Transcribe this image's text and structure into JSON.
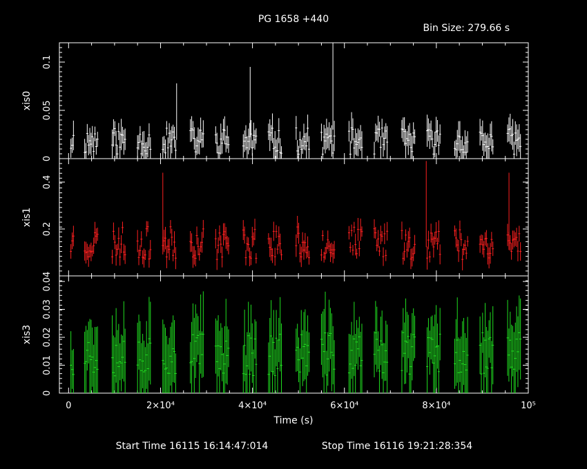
{
  "header": {
    "title": "PG 1658 +440",
    "bin_size": "Bin Size: 279.66 s"
  },
  "footer": {
    "start_time": "Start Time 16115 16:14:47:014",
    "stop_time": "Stop Time 16116 19:21:28:354"
  },
  "chart_data": [
    {
      "type": "scatter",
      "title": "PG 1658 +440",
      "ylabel": "xis0",
      "xlabel": "",
      "xlim": [
        -2000,
        100000
      ],
      "ylim": [
        0,
        0.12
      ],
      "yticks": [
        "0",
        "0.05",
        "0.1"
      ],
      "ytick_values": [
        0,
        0.05,
        0.1
      ],
      "color": "#ffffff",
      "seed": 11,
      "segments": [
        [
          500,
          1300
        ],
        [
          3500,
          6500
        ],
        [
          9500,
          12500
        ],
        [
          15000,
          18000
        ],
        [
          20500,
          23500
        ],
        [
          26500,
          29500
        ],
        [
          32000,
          35000
        ],
        [
          38000,
          41000
        ],
        [
          43500,
          46500
        ],
        [
          49500,
          52500
        ],
        [
          55000,
          58000
        ],
        [
          61000,
          64000
        ],
        [
          66500,
          69500
        ],
        [
          72500,
          75500
        ],
        [
          78000,
          81000
        ],
        [
          84000,
          87000
        ],
        [
          89500,
          92500
        ],
        [
          95500,
          98500
        ]
      ],
      "level": 0.018,
      "spread": 0.014,
      "err": 0.012,
      "spikes": [
        [
          39500,
          0.095
        ],
        [
          57500,
          0.12
        ],
        [
          23500,
          0.078
        ]
      ]
    },
    {
      "type": "scatter",
      "ylabel": "xis1",
      "xlabel": "",
      "xlim": [
        -2000,
        100000
      ],
      "ylim": [
        0,
        0.5
      ],
      "yticks": [
        "0.2",
        "0.4"
      ],
      "ytick_values": [
        0.2,
        0.4
      ],
      "color": "#ff2020",
      "seed": 23,
      "segments": [
        [
          500,
          1300
        ],
        [
          3500,
          6500
        ],
        [
          9500,
          12500
        ],
        [
          15000,
          18000
        ],
        [
          20500,
          23500
        ],
        [
          26500,
          29500
        ],
        [
          32000,
          35000
        ],
        [
          38000,
          41000
        ],
        [
          43500,
          46500
        ],
        [
          49500,
          52500
        ],
        [
          55000,
          58000
        ],
        [
          61000,
          64000
        ],
        [
          66500,
          69500
        ],
        [
          72500,
          75500
        ],
        [
          78000,
          81000
        ],
        [
          84000,
          87000
        ],
        [
          89500,
          92500
        ],
        [
          95500,
          98500
        ]
      ],
      "level": 0.14,
      "spread": 0.07,
      "err": 0.035,
      "spikes": [
        [
          77800,
          0.49
        ],
        [
          20500,
          0.44
        ],
        [
          95800,
          0.44
        ]
      ]
    },
    {
      "type": "scatter",
      "ylabel": "xis3",
      "xlabel": "Time (s)",
      "xlim": [
        -2000,
        100000
      ],
      "ylim": [
        0,
        0.042
      ],
      "yticks": [
        "0",
        "0.01",
        "0.02",
        "0.03",
        "0.04"
      ],
      "ytick_values": [
        0,
        0.01,
        0.02,
        0.03,
        0.04
      ],
      "xticks": [
        "0",
        "2×10⁴",
        "4×10⁴",
        "6×10⁴",
        "8×10⁴",
        "10⁵"
      ],
      "xtick_values": [
        0,
        20000,
        40000,
        60000,
        80000,
        100000
      ],
      "color": "#20e020",
      "seed": 37,
      "segments": [
        [
          500,
          1300
        ],
        [
          3500,
          6500
        ],
        [
          9500,
          12500
        ],
        [
          15000,
          18000
        ],
        [
          20500,
          23500
        ],
        [
          26500,
          29500
        ],
        [
          32000,
          35000
        ],
        [
          38000,
          41000
        ],
        [
          43500,
          46500
        ],
        [
          49500,
          52500
        ],
        [
          55000,
          58000
        ],
        [
          61000,
          64000
        ],
        [
          66500,
          69500
        ],
        [
          72500,
          75500
        ],
        [
          78000,
          81000
        ],
        [
          84000,
          87000
        ],
        [
          89500,
          92500
        ],
        [
          95500,
          98500
        ]
      ],
      "level": 0.014,
      "spread": 0.008,
      "err": 0.011,
      "spikes": []
    }
  ]
}
